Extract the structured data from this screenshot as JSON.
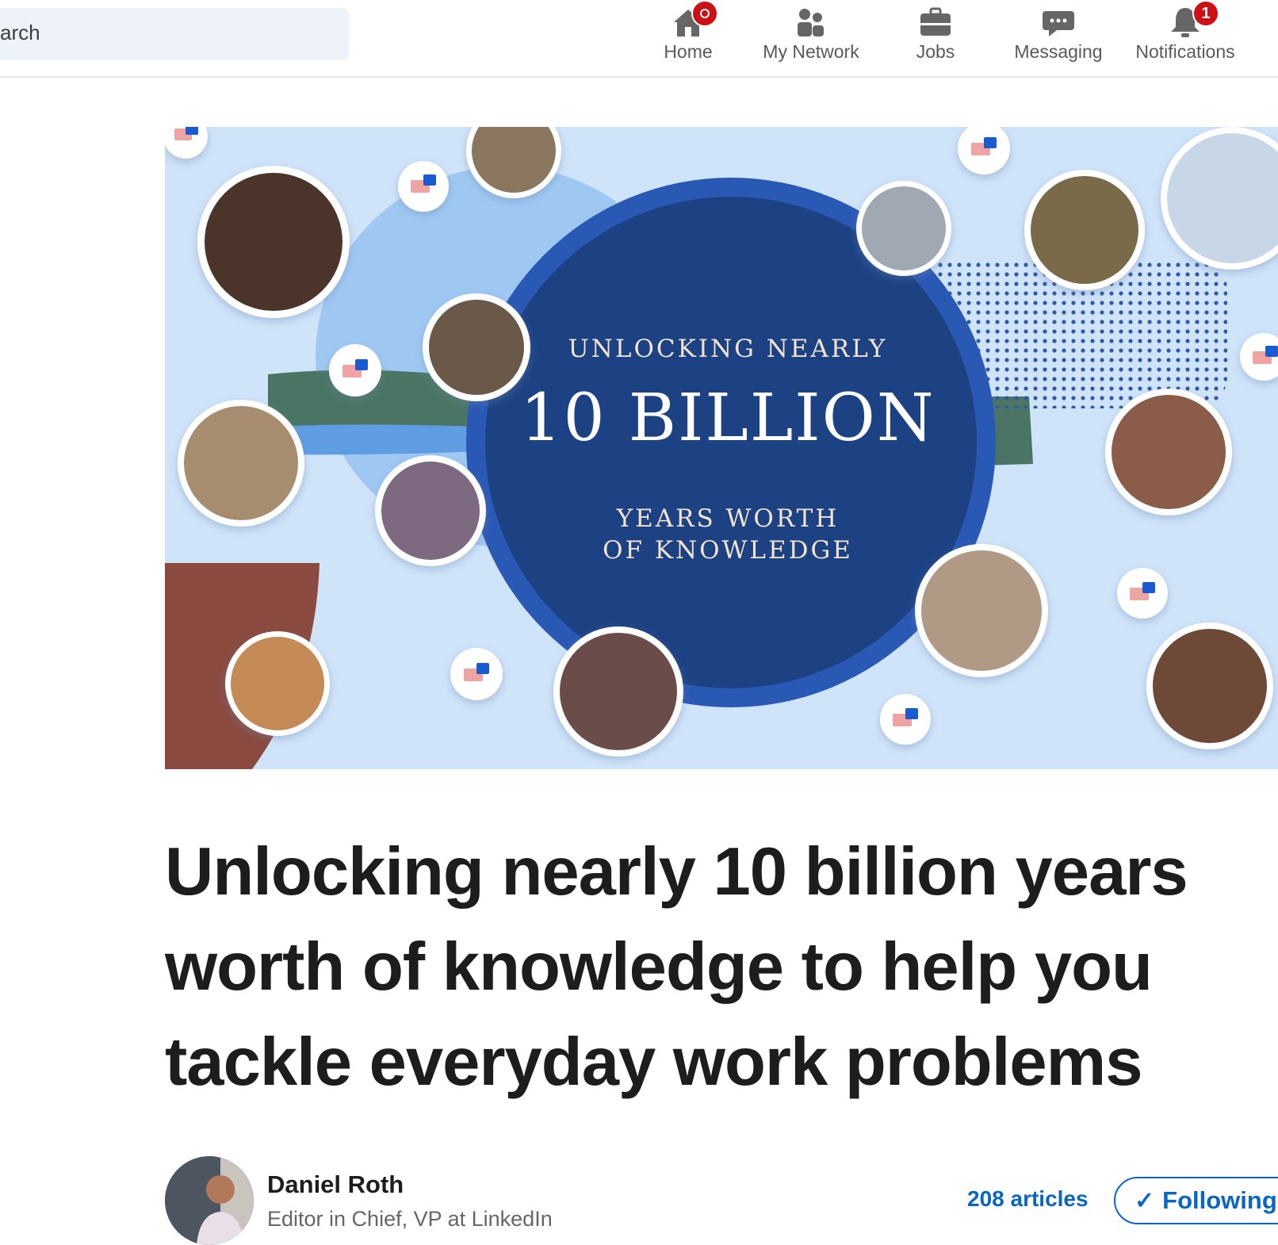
{
  "search": {
    "value": "arch"
  },
  "nav": {
    "home": "Home",
    "network": "My Network",
    "jobs": "Jobs",
    "messaging": "Messaging",
    "notifications": "Notifications",
    "notifications_badge": "1"
  },
  "banner": {
    "line1": "UNLOCKING NEARLY",
    "line2": "10 BILLION",
    "line3a": "YEARS WORTH",
    "line3b": "OF KNOWLEDGE"
  },
  "article": {
    "headline_1": "Unlocking nearly 10 billion years",
    "headline_2": "worth of knowledge to help you",
    "headline_3": "tackle everyday work problems"
  },
  "author": {
    "name": "Daniel Roth",
    "title": "Editor in Chief, VP at LinkedIn",
    "articles": "208 articles",
    "follow_label": "Following"
  },
  "colors": {
    "accent": "#0a66c2",
    "badge": "#cc1016",
    "banner_circle": "#1d4283"
  }
}
